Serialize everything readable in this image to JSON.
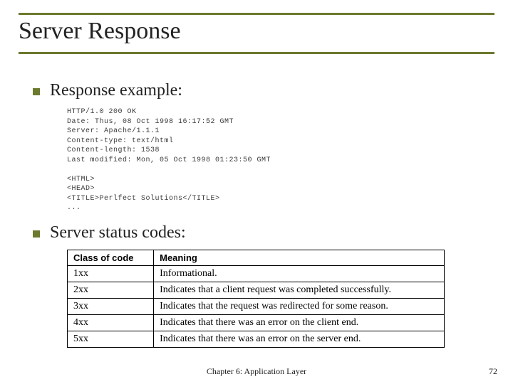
{
  "title": "Server Response",
  "bullets": {
    "b1": "Response example:",
    "b2": "Server status codes:"
  },
  "code": {
    "l1": "HTTP/1.0 200 OK",
    "l2": "Date: Thus, 08 Oct 1998 16:17:52 GMT",
    "l3": "Server: Apache/1.1.1",
    "l4": "Content-type: text/html",
    "l5": "Content-length: 1538",
    "l6": "Last modified: Mon, 05 Oct 1998 01:23:50 GMT",
    "l7": "",
    "l8": "<HTML>",
    "l9": "<HEAD>",
    "l10": "<TITLE>Perlfect Solutions</TITLE>",
    "l11": "..."
  },
  "table": {
    "h1": "Class of code",
    "h2": "Meaning",
    "rows": [
      {
        "c1": "1xx",
        "c2": "Informational."
      },
      {
        "c1": "2xx",
        "c2": "Indicates that a client request was completed successfully."
      },
      {
        "c1": "3xx",
        "c2": "Indicates that the request was redirected for some reason."
      },
      {
        "c1": "4xx",
        "c2": "Indicates that there was an error on the client end."
      },
      {
        "c1": "5xx",
        "c2": "Indicates that there was an error on the server end."
      }
    ]
  },
  "footer": "Chapter 6: Application Layer",
  "page": "72"
}
